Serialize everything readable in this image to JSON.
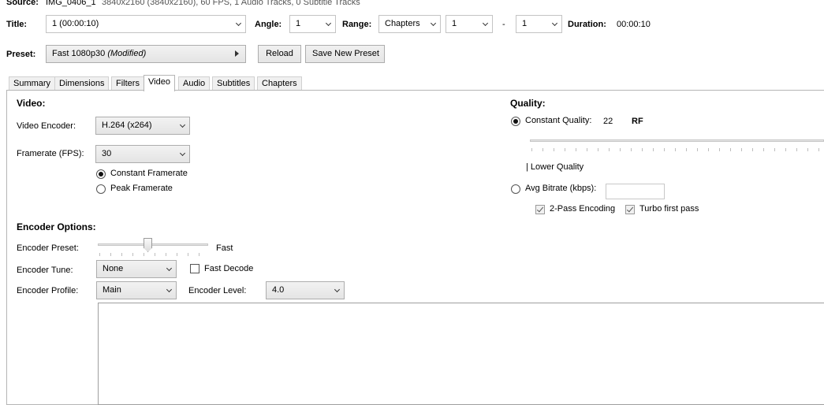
{
  "source": {
    "label": "Source:",
    "name": "IMG_0406_1",
    "info": "3840x2160 (3840x2160), 60 FPS, 1 Audio Tracks, 0 Subtitle Tracks"
  },
  "title_row": {
    "title_label": "Title:",
    "title_value": "1 (00:00:10)",
    "angle_label": "Angle:",
    "angle_value": "1",
    "range_label": "Range:",
    "range_type": "Chapters",
    "range_start": "1",
    "range_dash": "-",
    "range_end": "1",
    "duration_label": "Duration:",
    "duration_value": "00:00:10"
  },
  "preset": {
    "label": "Preset:",
    "name": "Fast 1080p30",
    "modified": "(Modified)",
    "reload": "Reload",
    "save_new": "Save New Preset"
  },
  "tabs": [
    {
      "label": "Summary"
    },
    {
      "label": "Dimensions"
    },
    {
      "label": "Filters"
    },
    {
      "label": "Video",
      "active": true
    },
    {
      "label": "Audio"
    },
    {
      "label": "Subtitles"
    },
    {
      "label": "Chapters"
    }
  ],
  "video": {
    "heading": "Video:",
    "encoder_label": "Video Encoder:",
    "encoder_value": "H.264 (x264)",
    "framerate_label": "Framerate (FPS):",
    "framerate_value": "30",
    "constant_framerate": "Constant Framerate",
    "peak_framerate": "Peak Framerate",
    "framerate_mode": "constant"
  },
  "quality": {
    "heading": "Quality:",
    "constant_quality_label": "Constant Quality:",
    "constant_quality_value": "22",
    "rf": "RF",
    "lower_quality": "| Lower Quality",
    "avg_bitrate_label": "Avg Bitrate (kbps):",
    "avg_bitrate_value": "",
    "two_pass": "2-Pass Encoding",
    "turbo": "Turbo first pass",
    "mode": "constant"
  },
  "encoder_options": {
    "heading": "Encoder Options:",
    "preset_label": "Encoder Preset:",
    "preset_value": "Fast",
    "preset_slider_fraction": 0.45,
    "tune_label": "Encoder Tune:",
    "tune_value": "None",
    "fast_decode": "Fast Decode",
    "profile_label": "Encoder Profile:",
    "profile_value": "Main",
    "level_label": "Encoder Level:",
    "level_value": "4.0",
    "extra_options": ""
  }
}
